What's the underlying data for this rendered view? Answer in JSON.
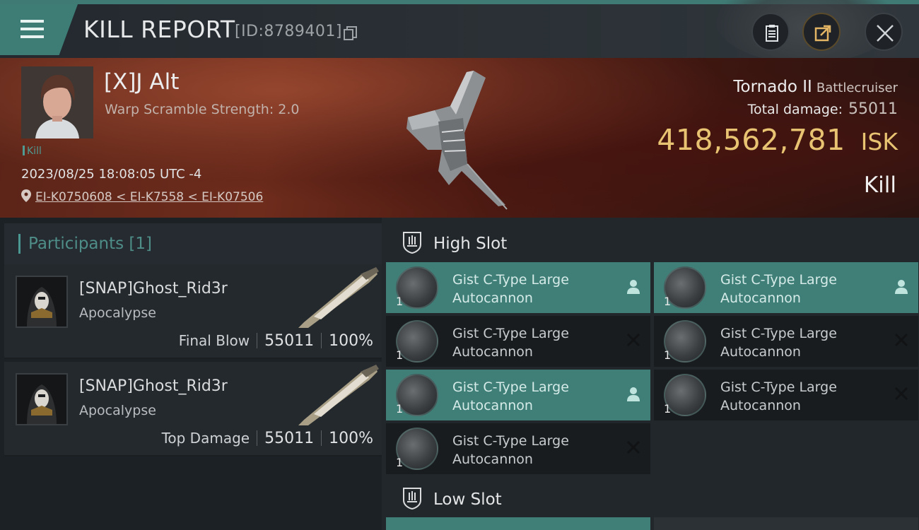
{
  "header": {
    "title": "KILL REPORT",
    "report_id": "[ID:8789401]"
  },
  "victim": {
    "name": "[X]J Alt",
    "warp_scramble": "Warp Scramble Strength: 2.0",
    "kill_tag": "Kill",
    "datetime": "2023/08/25 18:08:05 UTC -4",
    "location": "EI-K0750608 < EI-K7558 < EI-K07506"
  },
  "ship": {
    "name": "Tornado II",
    "class": "Battlecruiser",
    "total_damage_label": "Total damage:",
    "total_damage": "55011",
    "isk_value": "418,562,781",
    "isk_unit": "ISK",
    "result": "Kill"
  },
  "participants": {
    "title": "Participants [1]",
    "rows": [
      {
        "name": "[SNAP]Ghost_Rid3r",
        "ship": "Apocalypse",
        "role": "Final Blow",
        "damage": "55011",
        "percent": "100%"
      },
      {
        "name": "[SNAP]Ghost_Rid3r",
        "ship": "Apocalypse",
        "role": "Top Damage",
        "damage": "55011",
        "percent": "100%"
      }
    ]
  },
  "slots": {
    "high_title": "High Slot",
    "low_title": "Low Slot",
    "modules": [
      {
        "line1": "Gist C-Type Large",
        "line2": "Autocannon",
        "qty": "1",
        "state": "fitted"
      },
      {
        "line1": "Gist C-Type Large",
        "line2": "Autocannon",
        "qty": "1",
        "state": "fitted"
      },
      {
        "line1": "Gist C-Type Large",
        "line2": "Autocannon",
        "qty": "1",
        "state": "destroyed"
      },
      {
        "line1": "Gist C-Type Large",
        "line2": "Autocannon",
        "qty": "1",
        "state": "destroyed"
      },
      {
        "line1": "Gist C-Type Large",
        "line2": "Autocannon",
        "qty": "1",
        "state": "fitted"
      },
      {
        "line1": "Gist C-Type Large",
        "line2": "Autocannon",
        "qty": "1",
        "state": "destroyed"
      },
      {
        "line1": "Gist C-Type Large",
        "line2": "Autocannon",
        "qty": "1",
        "state": "destroyed"
      }
    ]
  },
  "colors": {
    "accent_teal": "#3f7f78",
    "isk_gold": "#e8c372",
    "hero_red": "#6e2c1c"
  },
  "icons": {
    "menu": "hamburger-menu-icon",
    "copy": "copy-icon",
    "clipboard": "clipboard-icon",
    "share": "share-icon",
    "close": "close-icon",
    "location": "location-pin-icon",
    "slot": "high-slot-icon",
    "fitted": "person-icon",
    "destroyed": "cross-icon"
  }
}
